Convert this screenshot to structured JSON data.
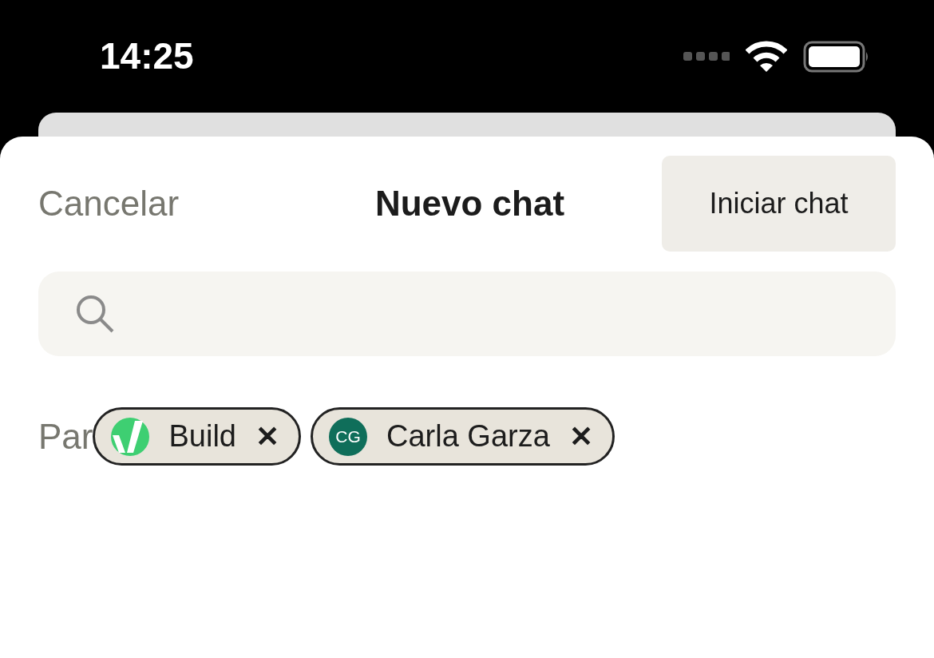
{
  "status_bar": {
    "time": "14:25"
  },
  "header": {
    "cancel": "Cancelar",
    "title": "Nuevo chat",
    "start": "Iniciar chat"
  },
  "recipients": {
    "label": "Par",
    "chips": [
      {
        "kind": "logo",
        "name": "Build",
        "remove": "✕"
      },
      {
        "kind": "initials",
        "initials": "CG",
        "color": "#0f6e5a",
        "name": "Carla Garza",
        "remove": "✕"
      }
    ]
  }
}
